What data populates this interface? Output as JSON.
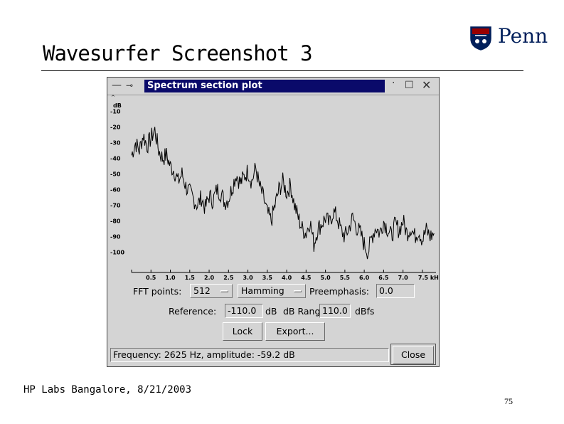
{
  "slide": {
    "title": "Wavesurfer Screenshot 3",
    "logo_text": "Penn",
    "footer": "HP Labs Bangalore, 8/21/2003",
    "page_number": "75"
  },
  "window": {
    "title": "Spectrum section plot",
    "controls": {
      "fft_label": "FFT points:",
      "fft_value": "512",
      "window_value": "Hamming",
      "preemphasis_label": "Preemphasis:",
      "preemphasis_value": "0.0",
      "reference_label": "Reference:",
      "reference_value": "-110.0",
      "range_label": "dB Range:",
      "range_prefix": "dB",
      "range_value": "110.0",
      "range_unit": "dBfs",
      "lock_label": "Lock",
      "export_label": "Export...",
      "close_label": "Close"
    },
    "status_text": "Frequency: 2625 Hz, amplitude: -59.2 dB"
  },
  "chart_data": {
    "type": "line",
    "ylabel": "dB",
    "y_ticks": [
      "-10",
      "-20",
      "-30",
      "-40",
      "-50",
      "-60",
      "-70",
      "-80",
      "-90",
      "-100"
    ],
    "x_ticks": [
      "0.5",
      "1.0",
      "1.5",
      "2.0",
      "2.5",
      "3.0",
      "3.5",
      "4.0",
      "4.5",
      "5.0",
      "5.5",
      "6.0",
      "6.5",
      "7.0",
      "7.5 kHz"
    ],
    "x_tick_values": [
      0.5,
      1.0,
      1.5,
      2.0,
      2.5,
      3.0,
      3.5,
      4.0,
      4.5,
      5.0,
      5.5,
      6.0,
      6.5,
      7.0,
      7.5
    ],
    "xlim": [
      0,
      7.85
    ],
    "ylim": [
      -113,
      -2
    ],
    "line_color": "#000000",
    "series": [
      {
        "x": [
          0.0,
          0.1,
          0.2,
          0.3,
          0.4,
          0.5,
          0.6,
          0.7,
          0.8,
          0.9,
          1.0,
          1.1,
          1.2,
          1.3,
          1.4,
          1.5,
          1.6,
          1.7,
          1.8,
          1.9,
          2.0,
          2.1,
          2.2,
          2.3,
          2.4,
          2.5,
          2.6,
          2.7,
          2.8,
          2.9,
          3.0,
          3.1,
          3.2,
          3.3,
          3.4,
          3.5,
          3.6,
          3.7,
          3.8,
          3.9,
          4.0,
          4.1,
          4.2,
          4.3,
          4.4,
          4.5,
          4.6,
          4.7,
          4.8,
          4.9,
          5.0,
          5.1,
          5.2,
          5.3,
          5.4,
          5.5,
          5.6,
          5.7,
          5.8,
          5.9,
          6.0,
          6.1,
          6.2,
          6.3,
          6.4,
          6.5,
          6.6,
          6.7,
          6.8,
          6.9,
          7.0,
          7.1,
          7.2,
          7.3,
          7.4,
          7.5,
          7.6,
          7.7,
          7.8
        ],
        "values": [
          -38,
          -30,
          -35,
          -25,
          -32,
          -27,
          -22,
          -35,
          -40,
          -38,
          -45,
          -48,
          -55,
          -50,
          -58,
          -62,
          -66,
          -70,
          -65,
          -72,
          -64,
          -67,
          -60,
          -62,
          -68,
          -66,
          -58,
          -50,
          -56,
          -52,
          -48,
          -55,
          -46,
          -58,
          -65,
          -75,
          -80,
          -70,
          -60,
          -55,
          -62,
          -57,
          -70,
          -78,
          -85,
          -88,
          -80,
          -95,
          -85,
          -82,
          -78,
          -82,
          -74,
          -78,
          -86,
          -90,
          -85,
          -78,
          -84,
          -88,
          -95,
          -100,
          -90,
          -84,
          -88,
          -80,
          -85,
          -90,
          -82,
          -86,
          -80,
          -88,
          -84,
          -90,
          -86,
          -92,
          -86,
          -90,
          -88
        ]
      }
    ]
  }
}
